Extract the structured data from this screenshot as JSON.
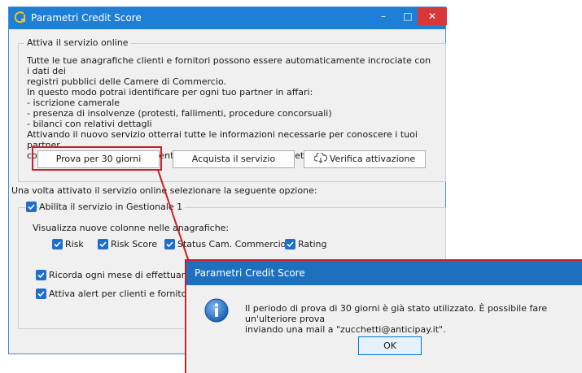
{
  "window": {
    "title": "Parametri Credit Score",
    "minimize_glyph": "–",
    "maximize_glyph": "□",
    "close_glyph": "✕"
  },
  "service_group": {
    "legend": "Attiva il servizio online",
    "description": "Tutte le tue anagrafiche clienti e fornitori possono essere automaticamente incrociate con i dati dei\nregistri pubblici delle Camere di Commercio.\nIn questo modo potrai identificare per ogni tuo partner in affari:\n- iscrizione camerale\n- presenza di insolvenze (protesti, fallimenti, procedure concorsuali)\n- bilanci con relativi dettagli\nAttivando il nuovo servizio otterrai tutte le informazioni necessarie per conoscere i tuoi partner\ncommerciali e intercettare eventuali negatività prima di emettere una nuova fattura.",
    "trial_button": "Prova per 30 giorni",
    "buy_button": "Acquista il servizio",
    "verify_button": "Verifica attivazione"
  },
  "options": {
    "intro": "Una volta attivato il servizio online selezionare la seguente opzione:",
    "enable_label": "Abilita il servizio in Gestionale 1",
    "columns_label": "Visualizza nuove colonne nelle anagrafiche:",
    "columns": [
      "Risk",
      "Risk Score",
      "Status Cam. Commercio",
      "Rating"
    ],
    "remind_label": "Ricorda ogni mese di effettuare l'a",
    "alert_label": "Attiva alert per clienti e fornitori co"
  },
  "dialog": {
    "title": "Parametri Credit Score",
    "message": "Il periodo di prova di 30 giorni è già stato utilizzato. È possibile fare un'ulteriore prova\ninviando una mail a \"zucchetti@anticipay.it\".",
    "ok_label": "OK"
  },
  "colors": {
    "titlebar": "#1e7fd6",
    "dialog_titlebar": "#1f6fbf",
    "highlight": "#c9202a",
    "checkbox": "#1e6fcc"
  }
}
